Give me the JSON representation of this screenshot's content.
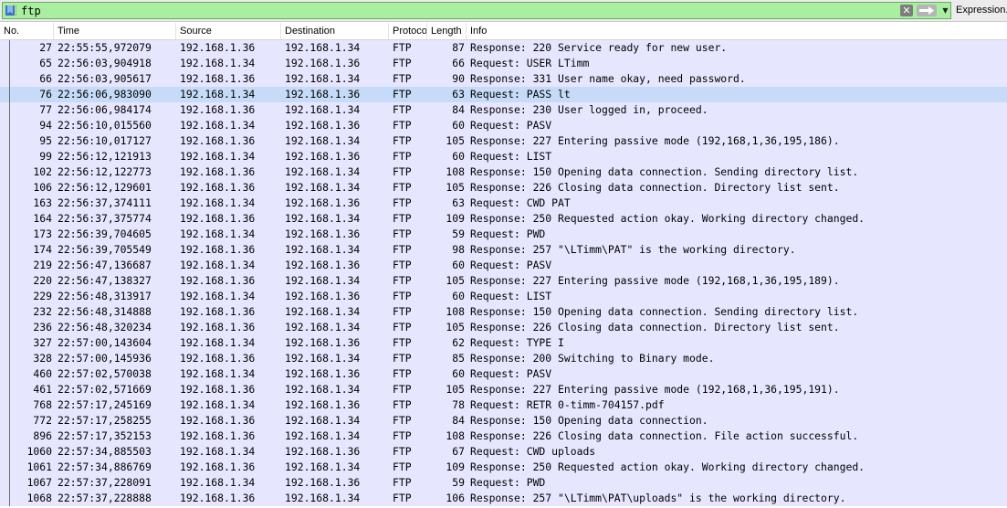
{
  "filter_bar": {
    "filter_text": "ftp",
    "clear_icon": "clear-x-icon",
    "apply_icon": "apply-arrow-icon",
    "bookmark_icon": "bookmark-icon",
    "dropdown_icon": "chevron-down-icon",
    "expression_label": "Expression...",
    "field_color": "#a8f0a0"
  },
  "columns": [
    "No.",
    "Time",
    "Source",
    "Destination",
    "Protocol",
    "Length",
    "Info"
  ],
  "row_color": "#e7e6ff",
  "selected_row_color": "#c6dbf8",
  "selected_no": "76",
  "packets": [
    [
      "27",
      "22:55:55,972079",
      "192.168.1.36",
      "192.168.1.34",
      "FTP",
      "87",
      "Response: 220 Service ready for new user."
    ],
    [
      "65",
      "22:56:03,904918",
      "192.168.1.34",
      "192.168.1.36",
      "FTP",
      "66",
      "Request: USER LTimm"
    ],
    [
      "66",
      "22:56:03,905617",
      "192.168.1.36",
      "192.168.1.34",
      "FTP",
      "90",
      "Response: 331 User name okay, need password."
    ],
    [
      "76",
      "22:56:06,983090",
      "192.168.1.34",
      "192.168.1.36",
      "FTP",
      "63",
      "Request: PASS lt"
    ],
    [
      "77",
      "22:56:06,984174",
      "192.168.1.36",
      "192.168.1.34",
      "FTP",
      "84",
      "Response: 230 User logged in, proceed."
    ],
    [
      "94",
      "22:56:10,015560",
      "192.168.1.34",
      "192.168.1.36",
      "FTP",
      "60",
      "Request: PASV"
    ],
    [
      "95",
      "22:56:10,017127",
      "192.168.1.36",
      "192.168.1.34",
      "FTP",
      "105",
      "Response: 227 Entering passive mode (192,168,1,36,195,186)."
    ],
    [
      "99",
      "22:56:12,121913",
      "192.168.1.34",
      "192.168.1.36",
      "FTP",
      "60",
      "Request: LIST"
    ],
    [
      "102",
      "22:56:12,122773",
      "192.168.1.36",
      "192.168.1.34",
      "FTP",
      "108",
      "Response: 150 Opening data connection. Sending directory list."
    ],
    [
      "106",
      "22:56:12,129601",
      "192.168.1.36",
      "192.168.1.34",
      "FTP",
      "105",
      "Response: 226 Closing data connection. Directory list sent."
    ],
    [
      "163",
      "22:56:37,374111",
      "192.168.1.34",
      "192.168.1.36",
      "FTP",
      "63",
      "Request: CWD PAT"
    ],
    [
      "164",
      "22:56:37,375774",
      "192.168.1.36",
      "192.168.1.34",
      "FTP",
      "109",
      "Response: 250 Requested action okay. Working directory changed."
    ],
    [
      "173",
      "22:56:39,704605",
      "192.168.1.34",
      "192.168.1.36",
      "FTP",
      "59",
      "Request: PWD"
    ],
    [
      "174",
      "22:56:39,705549",
      "192.168.1.36",
      "192.168.1.34",
      "FTP",
      "98",
      "Response: 257 \"\\LTimm\\PAT\" is the working directory."
    ],
    [
      "219",
      "22:56:47,136687",
      "192.168.1.34",
      "192.168.1.36",
      "FTP",
      "60",
      "Request: PASV"
    ],
    [
      "220",
      "22:56:47,138327",
      "192.168.1.36",
      "192.168.1.34",
      "FTP",
      "105",
      "Response: 227 Entering passive mode (192,168,1,36,195,189)."
    ],
    [
      "229",
      "22:56:48,313917",
      "192.168.1.34",
      "192.168.1.36",
      "FTP",
      "60",
      "Request: LIST"
    ],
    [
      "232",
      "22:56:48,314888",
      "192.168.1.36",
      "192.168.1.34",
      "FTP",
      "108",
      "Response: 150 Opening data connection. Sending directory list."
    ],
    [
      "236",
      "22:56:48,320234",
      "192.168.1.36",
      "192.168.1.34",
      "FTP",
      "105",
      "Response: 226 Closing data connection. Directory list sent."
    ],
    [
      "327",
      "22:57:00,143604",
      "192.168.1.34",
      "192.168.1.36",
      "FTP",
      "62",
      "Request: TYPE I"
    ],
    [
      "328",
      "22:57:00,145936",
      "192.168.1.36",
      "192.168.1.34",
      "FTP",
      "85",
      "Response: 200 Switching to Binary mode."
    ],
    [
      "460",
      "22:57:02,570038",
      "192.168.1.34",
      "192.168.1.36",
      "FTP",
      "60",
      "Request: PASV"
    ],
    [
      "461",
      "22:57:02,571669",
      "192.168.1.36",
      "192.168.1.34",
      "FTP",
      "105",
      "Response: 227 Entering passive mode (192,168,1,36,195,191)."
    ],
    [
      "768",
      "22:57:17,245169",
      "192.168.1.34",
      "192.168.1.36",
      "FTP",
      "78",
      "Request: RETR 0-timm-704157.pdf"
    ],
    [
      "772",
      "22:57:17,258255",
      "192.168.1.36",
      "192.168.1.34",
      "FTP",
      "84",
      "Response: 150 Opening data connection."
    ],
    [
      "896",
      "22:57:17,352153",
      "192.168.1.36",
      "192.168.1.34",
      "FTP",
      "108",
      "Response: 226 Closing data connection. File action successful."
    ],
    [
      "1060",
      "22:57:34,885503",
      "192.168.1.34",
      "192.168.1.36",
      "FTP",
      "67",
      "Request: CWD uploads"
    ],
    [
      "1061",
      "22:57:34,886769",
      "192.168.1.36",
      "192.168.1.34",
      "FTP",
      "109",
      "Response: 250 Requested action okay. Working directory changed."
    ],
    [
      "1067",
      "22:57:37,228091",
      "192.168.1.34",
      "192.168.1.36",
      "FTP",
      "59",
      "Request: PWD"
    ],
    [
      "1068",
      "22:57:37,228888",
      "192.168.1.36",
      "192.168.1.34",
      "FTP",
      "106",
      "Response: 257 \"\\LTimm\\PAT\\uploads\" is the working directory."
    ]
  ]
}
